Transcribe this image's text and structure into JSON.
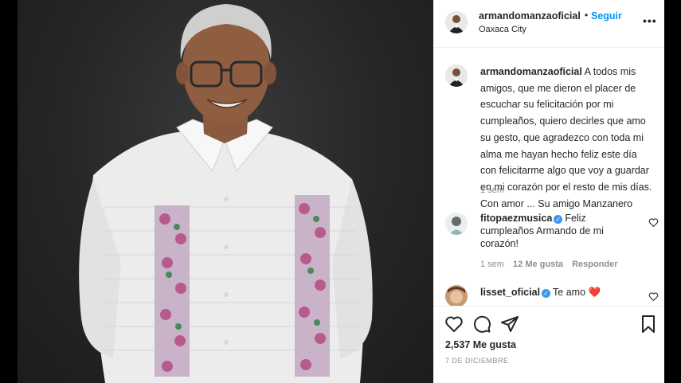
{
  "post": {
    "username": "armandomanzaoficial",
    "dot": "•",
    "follow_label": "Seguir",
    "location": "Oaxaca City",
    "more_label": "•••"
  },
  "caption": {
    "username": "armandomanzaoficial",
    "text": " A todos mis amigos, que me dieron el placer de escuchar su felicitación por mi cumpleaños, quiero decirles que amo su gesto, que agradezco con toda mi alma me hayan hecho feliz este día con felicitarme algo que voy a guardar en mi corazón por el resto de mis días. Con amor ... Su amigo Manzanero",
    "time": "1 sem"
  },
  "comments": [
    {
      "username": "fitopaezmusica",
      "verified": "✓",
      "text": "Feliz cumpleaños Armando de mi corazón!",
      "time": "1 sem",
      "likes": "12 Me gusta",
      "reply_label": "Responder"
    },
    {
      "username": "lisset_oficial",
      "verified": "✓",
      "text": "Te amo ",
      "emoji": "❤️"
    }
  ],
  "actions": {
    "likes": "2,537 Me gusta",
    "date": "7 DE DICIEMBRE"
  },
  "icons": {
    "like": "heart-outline-icon",
    "comment": "speech-bubble-icon",
    "share": "paper-plane-icon",
    "save": "bookmark-icon",
    "comment_like": "small-heart-icon"
  },
  "colors": {
    "link_blue": "#0095f6",
    "verified_blue": "#3897f0",
    "text": "#262626",
    "muted": "#8e8e8e",
    "border": "#efefef"
  }
}
